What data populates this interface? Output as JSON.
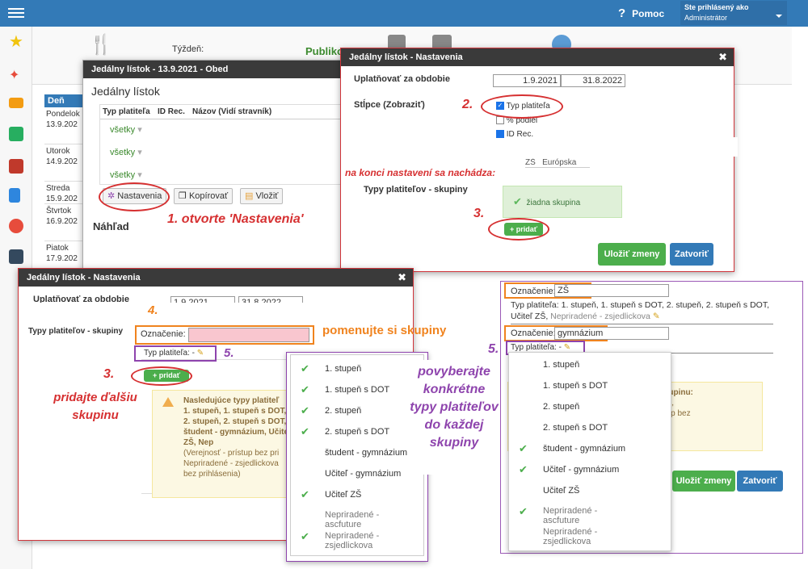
{
  "topbar": {
    "help": "Pomoc",
    "user_line1": "Ste prihlásený ako",
    "user_line2": "Administrátor"
  },
  "sidebar": {
    "icons": [
      "star-icon",
      "wand-icon",
      "mail-icon",
      "home-icon",
      "grid-icon",
      "book-icon",
      "user-icon",
      "calendar-icon"
    ]
  },
  "bg": {
    "week_label": "Týždeň:",
    "publish": "Publiko",
    "col_day": "Deň",
    "days": [
      {
        "name": "Pondelok",
        "date": "13.9.202"
      },
      {
        "name": "Utorok",
        "date": "14.9.202"
      },
      {
        "name": "Streda",
        "date": "15.9.202"
      },
      {
        "name": "Štvrtok",
        "date": "16.9.202"
      },
      {
        "name": "Piatok",
        "date": "17.9.202"
      }
    ]
  },
  "d1": {
    "title": "Jedálny lístok - 13.9.2021 - Obed",
    "heading": "Jedálny lístok",
    "cols": [
      "Typ platiteľa",
      "ID Rec.",
      "Názov (Vidí stravník)"
    ],
    "rows": [
      "všetky",
      "všetky",
      "všetky"
    ],
    "btn_settings": "Nastavenia",
    "btn_copy": "Kopírovať",
    "btn_paste": "Vložiť",
    "preview": "Náhľad"
  },
  "d2": {
    "title": "Jedálny lístok - Nastavenia",
    "period_label": "Uplatňovať za obdobie",
    "date_from": "1.9.2021",
    "date_to": "31.8.2022",
    "columns_label": "Stĺpce (Zobraziť)",
    "col_opts": [
      "Typ platiteľa",
      "% podiel",
      "ID Rec."
    ],
    "groups_label": "Typy platiteľov - skupiny",
    "no_group": "žiadna skupina",
    "add": "+ pridať",
    "save": "Uložiť zmeny",
    "close": "Zatvoriť"
  },
  "d3": {
    "title": "Jedálny lístok - Nastavenia",
    "period_label": "Uplatňovať za obdobie",
    "date_from": "1.9.2021",
    "date_to": "31.8.2022",
    "groups_label": "Typy platiteľov - skupiny",
    "name_label": "Označenie:",
    "payer_label": "Typ platiteľa: -",
    "add": "+ pridať",
    "warn_title": "Nasledujúce typy platiteľ",
    "warn_text": "1. stupeň, 1. stupeň s DOT, 2. stupeň, 2. stupeň s DOT, študent - gymnázium, Učiteľ ZŠ, Nep",
    "warn_text2": "(Verejnosť - prístup bez pri Nepriradené - zsjedlickova bez prihlásenia)"
  },
  "popup1": {
    "items": [
      {
        "label": "1. stupeň",
        "checked": true
      },
      {
        "label": "1. stupeň s DOT",
        "checked": true
      },
      {
        "label": "2. stupeň",
        "checked": true
      },
      {
        "label": "2. stupeň s DOT",
        "checked": true
      },
      {
        "label": "študent - gymnázium",
        "checked": false
      },
      {
        "label": "Učiteľ - gymnázium",
        "checked": false
      },
      {
        "label": "Učiteľ ZŠ",
        "checked": true
      },
      {
        "label": "Nepriradené - ascfuture",
        "checked": false
      },
      {
        "label": "Nepriradené - zsjedlickova",
        "checked": true
      }
    ]
  },
  "right": {
    "name1_label": "Označenie:",
    "name1_value": "ZŠ",
    "types1_prefix": "Typ platiteľa:",
    "types1": "1. stupeň, 1. stupeň s DOT, 2. stupeň, 2. stupeň s DOT, Učiteľ ZŠ,",
    "types1_gray": "Nepriradené - zsjedlickova",
    "name2_label": "Označenie:",
    "name2_value": "gymnázium",
    "payer2": "Typ platiteľa: -",
    "warn_partial": "ajú skupinu:",
    "warn_partial2": "názium,",
    "warn_partial3": "- prístup bez",
    "save": "Uložiť zmeny",
    "close": "Zatvoriť"
  },
  "popup2": {
    "items": [
      {
        "label": "1. stupeň",
        "checked": false
      },
      {
        "label": "1. stupeň s DOT",
        "checked": false
      },
      {
        "label": "2. stupeň",
        "checked": false
      },
      {
        "label": "2. stupeň s DOT",
        "checked": false
      },
      {
        "label": "študent - gymnázium",
        "checked": true
      },
      {
        "label": "Učiteľ - gymnázium",
        "checked": true
      },
      {
        "label": "Učiteľ ZŠ",
        "checked": false
      },
      {
        "label": "Nepriradené - ascfuture",
        "checked": true
      },
      {
        "label": "Nepriradené - zsjedlickova",
        "checked": false
      }
    ]
  },
  "ann": {
    "s1": "1.  otvorte 'Nastavenia'",
    "s2": "2.",
    "s3": "3.",
    "s3b": "3.",
    "s4": "4.",
    "s5": "5.",
    "s5b": "5.",
    "end": "na konci nastavení sa nachádza:",
    "add_more": "pridajte ďalšiu skupinu",
    "name_it": "pomenujte si skupiny",
    "pick": "povyberajte konkrétne typy platiteľov do každej skupiny"
  }
}
